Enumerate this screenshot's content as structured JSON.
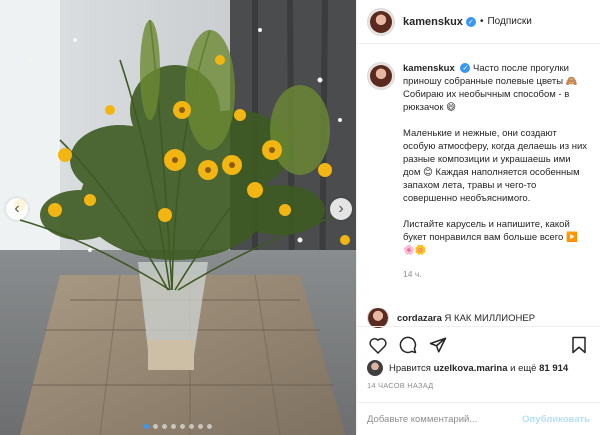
{
  "post": {
    "username": "kamenskux",
    "follow_label": "Подписки",
    "bullet": "•",
    "caption_paragraphs": [
      "Часто после прогулки приношу собранные полевые цветы 🙈 Собираю их необычным способом - в рюкзачок 😄",
      "Маленькие и нежные, они создают особую атмосферу, когда делаешь из них разные композиции и украшаешь ими дом 😊 Каждая наполняется особенным запахом лета, травы и чего-то совершенно необъяснимого.",
      "Листайте карусель и напишите, какой букет понравился вам больше всего ▶️🌸🌼"
    ],
    "caption_time": "14 ч.",
    "comment": {
      "username": "cordazara",
      "text": "Я КАК МИЛЛИОНЕР"
    },
    "likes": {
      "prefix": "Нравится",
      "user": "uzelkova.marina",
      "middle": "и ещё",
      "count": "81 914"
    },
    "date": "14 ЧАСОВ НАЗАД",
    "add_comment_placeholder": "Добавьте комментарий...",
    "publish_label": "Опубликовать"
  },
  "carousel": {
    "total": 8,
    "current": 1
  },
  "icons": {
    "verified": "verified-badge-icon",
    "like": "heart-icon",
    "comment": "comment-icon",
    "share": "share-icon",
    "save": "bookmark-icon",
    "prev": "chevron-left-icon",
    "next": "chevron-right-icon"
  },
  "colors": {
    "accent": "#3897f0",
    "publish_disabled": "#b2dffc",
    "muted": "#8e8e8e"
  }
}
